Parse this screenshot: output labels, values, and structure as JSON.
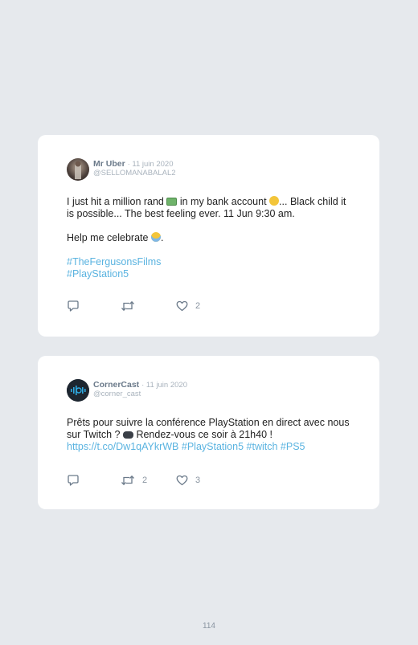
{
  "tweets": [
    {
      "name": "Mr Uber",
      "date": "· 11 juin 2020",
      "handle": "@SELLOMANABALAL2",
      "text_1": "I just hit a million rand",
      "text_2": "in my bank account",
      "text_3": "... Black child it is possible... The best feeling ever. 11 Jun 9:30 am.",
      "text_4": "Help me celebrate",
      "text_5": ".",
      "tags": [
        "#TheFergusonsFilms",
        "#PlayStation5"
      ],
      "retweets": "",
      "likes": "2",
      "icons": [
        "cash-emoji",
        "grinning-face-emoji",
        "raising-hands-emoji",
        "reply-icon",
        "retweet-icon",
        "heart-icon"
      ]
    },
    {
      "name": "CornerCast",
      "date": "· 11 juin 2020",
      "handle": "@corner_cast",
      "text_1": "Prêts pour suivre la conférence PlayStation en direct avec nous sur Twitch ?",
      "text_2": "Rendez-vous ce soir à 21h40 !",
      "link": "https://t.co/Dw1qAYkrWB",
      "tags": [
        "#PlayStation5",
        "#twitch",
        "#PS5"
      ],
      "retweets": "2",
      "likes": "3",
      "icons": [
        "gamepad-emoji",
        "reply-icon",
        "retweet-icon",
        "heart-icon"
      ]
    }
  ],
  "page_number": "114",
  "colors": {
    "background": "#e6e9ed",
    "card": "#ffffff",
    "link": "#5ab3e0",
    "meta": "#a9b3bd"
  }
}
